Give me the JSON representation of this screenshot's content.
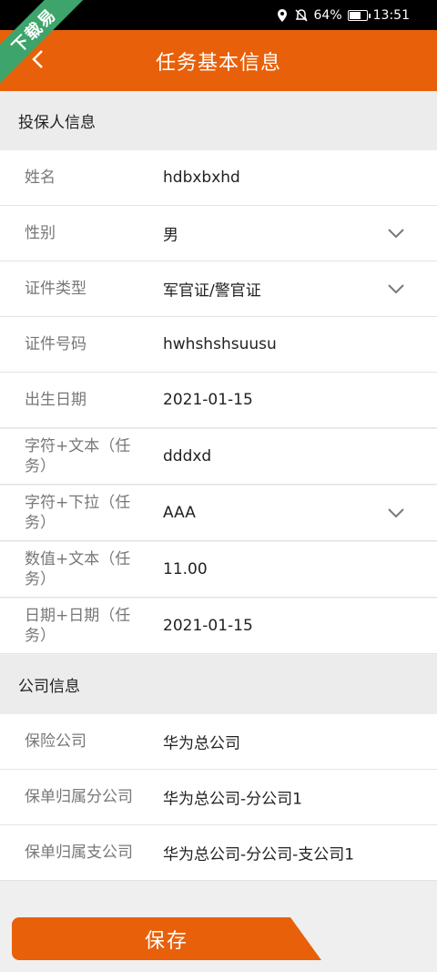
{
  "status_bar": {
    "battery": "64%",
    "time": "13:51"
  },
  "ribbon": {
    "label": "下载易"
  },
  "header": {
    "title": "任务基本信息"
  },
  "sections": {
    "applicant": {
      "title": "投保人信息"
    },
    "company": {
      "title": "公司信息"
    }
  },
  "applicant_rows": [
    {
      "label": "姓名",
      "value": "hdbxbxhd"
    },
    {
      "label": "性别",
      "value": "男"
    },
    {
      "label": "证件类型",
      "value": "军官证/警官证"
    },
    {
      "label": "证件号码",
      "value": "hwhshshsuusu"
    },
    {
      "label": "出生日期",
      "value": "2021-01-15"
    },
    {
      "label": "字符+文本（任务）",
      "value": "dddxd"
    },
    {
      "label": "字符+下拉（任务）",
      "value": "AAA"
    },
    {
      "label": "数值+文本（任务）",
      "value": "11.00"
    },
    {
      "label": "日期+日期（任务）",
      "value": "2021-01-15"
    }
  ],
  "company_rows": [
    {
      "label": "保险公司",
      "value": "华为总公司"
    },
    {
      "label": "保单归属分公司",
      "value": "华为总公司-分公司1"
    },
    {
      "label": "保单归属支公司",
      "value": "华为总公司-分公司-支公司1"
    }
  ],
  "actions": {
    "save_label": "保存"
  },
  "colors": {
    "accent": "#e8600a",
    "ribbon": "#3da46b"
  }
}
